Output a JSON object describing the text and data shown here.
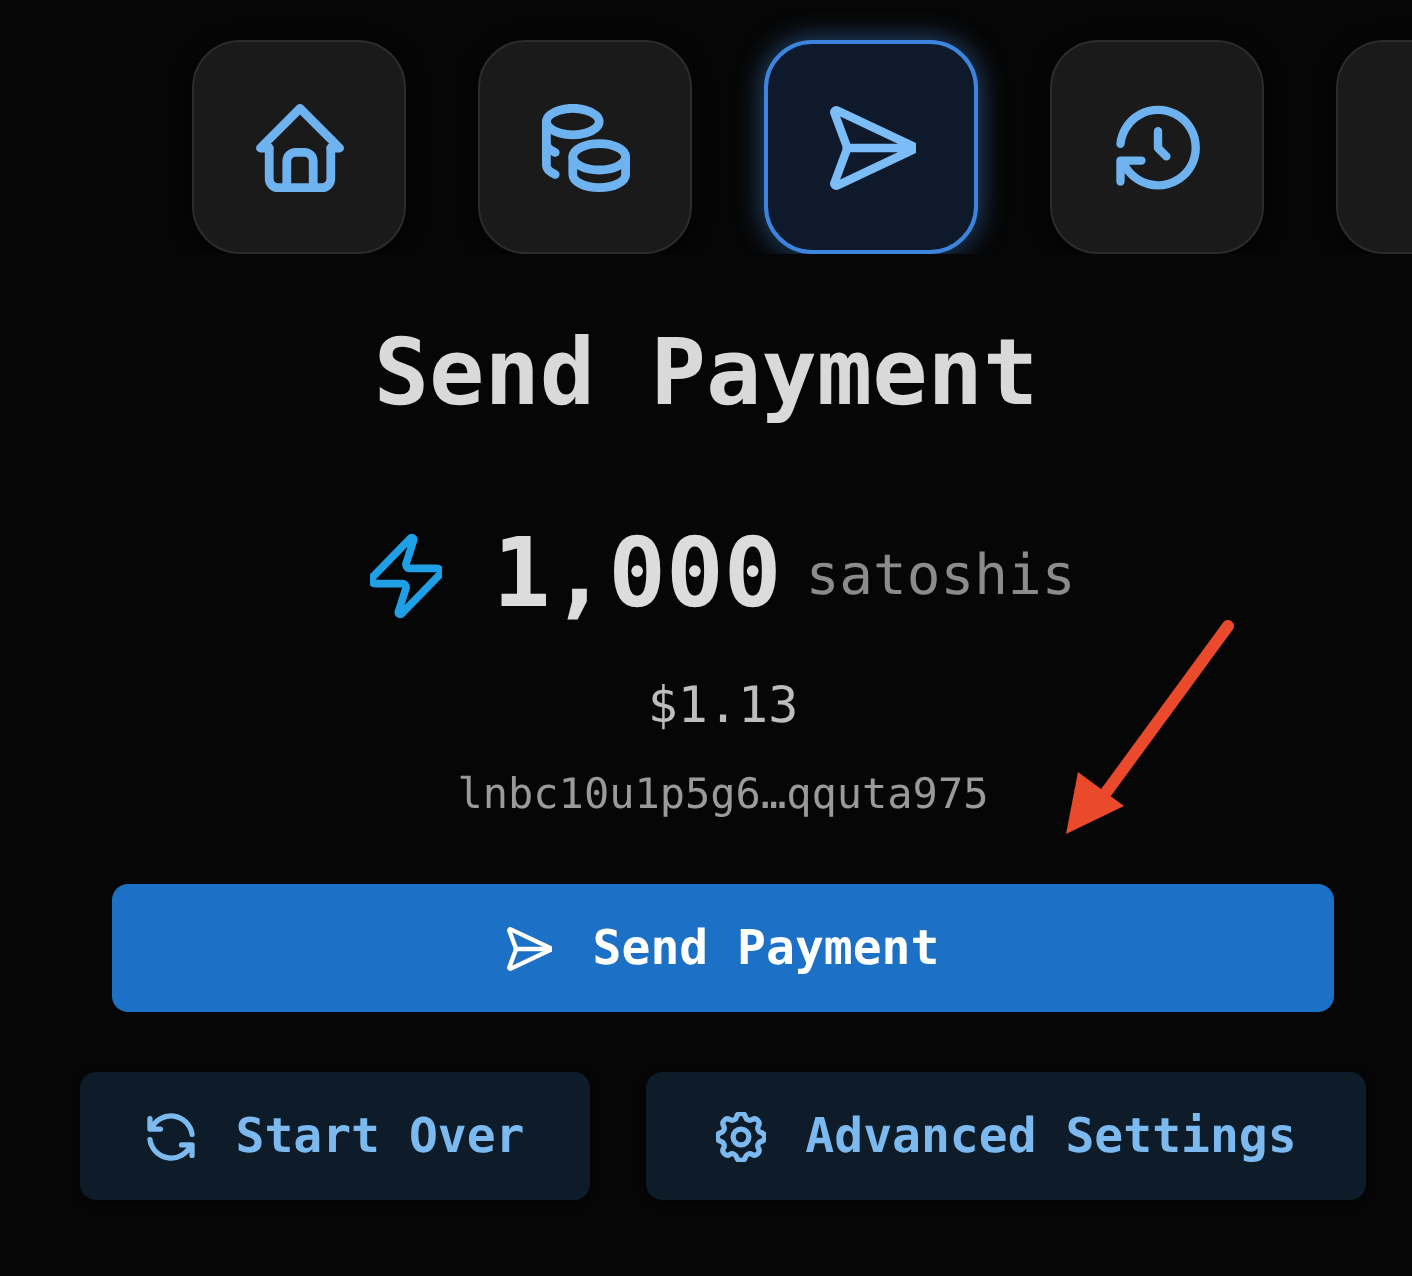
{
  "nav": [
    {
      "kind": "home",
      "selected": false
    },
    {
      "kind": "coins",
      "selected": false
    },
    {
      "kind": "send",
      "selected": true
    },
    {
      "kind": "history",
      "selected": false
    },
    {
      "kind": "other",
      "selected": false
    }
  ],
  "title": "Send Payment",
  "amount": {
    "value": "1,000",
    "unit": "satoshis"
  },
  "fiat_value": "$1.13",
  "invoice": "lnbc10u1p5g6…qquta975",
  "primary_button": {
    "label": "Send Payment"
  },
  "secondary_buttons": [
    {
      "kind": "restart",
      "label": "Start Over"
    },
    {
      "kind": "settings",
      "label": "Advanced Settings"
    }
  ],
  "annotations": [
    {
      "kind": "arrow"
    }
  ]
}
